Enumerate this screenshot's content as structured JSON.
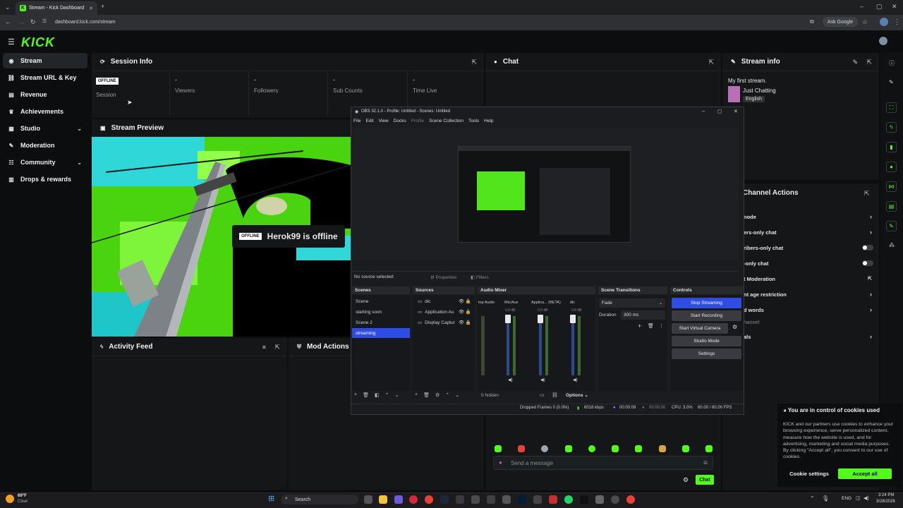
{
  "browser": {
    "tab_title": "Stream - Kick Dashboard",
    "url": "dashboard.kick.com/stream",
    "ask_google": "Ask Google"
  },
  "kick": {
    "logo": "KICK",
    "nav": [
      {
        "label": "Stream",
        "icon": "stream-icon"
      },
      {
        "label": "Stream URL & Key",
        "icon": "link-icon"
      },
      {
        "label": "Revenue",
        "icon": "revenue-icon"
      },
      {
        "label": "Achievements",
        "icon": "trophy-icon"
      },
      {
        "label": "Studio",
        "icon": "studio-icon"
      },
      {
        "label": "Moderation",
        "icon": "wrench-icon"
      },
      {
        "label": "Community",
        "icon": "community-icon"
      },
      {
        "label": "Drops & rewards",
        "icon": "gift-icon"
      }
    ]
  },
  "session": {
    "title": "Session Info",
    "badge": "OFFLINE",
    "stats": [
      {
        "value": "",
        "label": "Session"
      },
      {
        "value": "-",
        "label": "Viewers"
      },
      {
        "value": "-",
        "label": "Followers"
      },
      {
        "value": "-",
        "label": "Sub Counts"
      },
      {
        "value": "-",
        "label": "Time Live"
      }
    ]
  },
  "preview": {
    "title": "Stream Preview",
    "offline_badge": "OFFLINE",
    "offline_text": "Herok99 is offline"
  },
  "activity": {
    "title": "Activity Feed"
  },
  "mod_actions": {
    "title": "Mod Actions"
  },
  "chat": {
    "title": "Chat",
    "placeholder": "Send a message",
    "send_label": "Chat"
  },
  "stream_info": {
    "title": "Stream info",
    "stream_title": "My first stream.",
    "category": "Just Chatting",
    "language": "English"
  },
  "channel_actions": {
    "title": "Channel Actions",
    "items": [
      {
        "label": "node",
        "control": "chevron"
      },
      {
        "label": "ers-only chat",
        "control": "chevron"
      },
      {
        "label": "ribers-only chat",
        "control": "toggle"
      },
      {
        "label": "-only chat",
        "control": "toggle"
      },
      {
        "label": "t Moderation",
        "control": "external"
      },
      {
        "label": "nt age restriction",
        "control": "chevron"
      },
      {
        "label": "d words",
        "control": "chevron"
      },
      {
        "label": "hannel",
        "control": ""
      },
      {
        "label": "als",
        "control": "chevron"
      }
    ]
  },
  "obs": {
    "title": "OBS 32.1.0 - Profile: Untitled - Scenes: Untitled",
    "menu": [
      "File",
      "Edit",
      "View",
      "Docks",
      "Profile",
      "Scene Collection",
      "Tools",
      "Help"
    ],
    "no_source": "No source selected",
    "properties": "Properties",
    "filters": "Filters",
    "docks": {
      "scenes": "Scenes",
      "sources": "Sources",
      "mixer": "Audio Mixer",
      "transitions": "Scene Transitions",
      "controls": "Controls"
    },
    "scenes": [
      "Scene",
      "starting soon",
      "Scene 2",
      "streaming"
    ],
    "sources": [
      "dic",
      "Application Au",
      "Display Captur"
    ],
    "mixer_channels": [
      "top Audio",
      "Mic/Aux",
      "Applica... (BETA)",
      "dic"
    ],
    "mixer_db": "0.0 dB",
    "hidden": "0 hidden",
    "options": "Options",
    "transition": "Fade",
    "duration_label": "Duration",
    "duration_value": "300 ms",
    "controls": [
      "Stop Streaming",
      "Start Recording",
      "Start Virtual Camera",
      "Studio Mode",
      "Settings"
    ],
    "status": {
      "dropped": "Dropped Frames 0 (0.0%)",
      "kbps": "6018 kbps",
      "stream_time": "00:00:09",
      "rec_time": "00:00:00",
      "cpu": "CPU: 3.0%",
      "fps": "60.00 / 60.00 FPS"
    }
  },
  "cookie": {
    "title": "You are in control of cookies used",
    "body": "KICK and our partners use cookies to enhance your browsing experience, serve personalized content, measure how the website is used, and for advertising, marketing and social media purposes. By clicking \"Accept all\", you consent to our use of cookies.",
    "settings": "Cookie settings",
    "accept": "Accept all"
  },
  "taskbar": {
    "weather_temp": "69°F",
    "weather_text": "Clear",
    "search": "Search",
    "lang": "ENG",
    "time": "3:24 PM",
    "date": "3/28/2026"
  },
  "colors": {
    "kick_green": "#53fc18",
    "obs_blue": "#2f4de6"
  }
}
